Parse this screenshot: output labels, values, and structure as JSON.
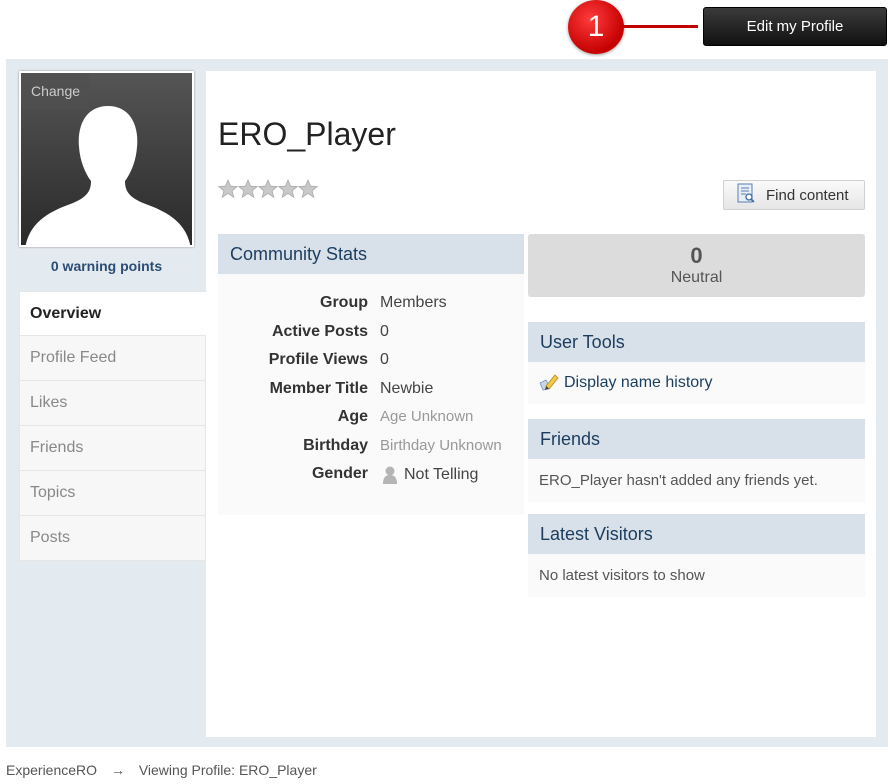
{
  "callout": {
    "number": "1"
  },
  "header": {
    "edit_profile_label": "Edit my Profile"
  },
  "avatar": {
    "change_label": "Change"
  },
  "warning_points": "0 warning points",
  "tabs": [
    "Overview",
    "Profile Feed",
    "Likes",
    "Friends",
    "Topics",
    "Posts"
  ],
  "profile": {
    "username": "ERO_Player",
    "rating_stars": 5
  },
  "find_content_label": "Find content",
  "community_stats": {
    "title": "Community Stats",
    "rows": [
      {
        "key": "Group",
        "value": "Members"
      },
      {
        "key": "Active Posts",
        "value": "0"
      },
      {
        "key": "Profile Views",
        "value": "0"
      },
      {
        "key": "Member Title",
        "value": "Newbie"
      },
      {
        "key": "Age",
        "value": "Age Unknown"
      },
      {
        "key": "Birthday",
        "value": "Birthday Unknown"
      },
      {
        "key": "Gender",
        "value": "Not Telling"
      }
    ]
  },
  "reputation": {
    "value": "0",
    "label": "Neutral"
  },
  "user_tools": {
    "title": "User Tools",
    "link": "Display name history"
  },
  "friends": {
    "title": "Friends",
    "text": "ERO_Player hasn't added any friends yet."
  },
  "latest_visitors": {
    "title": "Latest Visitors",
    "text": "No latest visitors to show"
  },
  "breadcrumb": {
    "home": "ExperienceRO",
    "arrow": "→",
    "current": "Viewing Profile: ERO_Player"
  },
  "colors": {
    "header_blue": "#d8e0e9",
    "link_blue": "#1c3d5e",
    "callout_red": "#c40000"
  }
}
